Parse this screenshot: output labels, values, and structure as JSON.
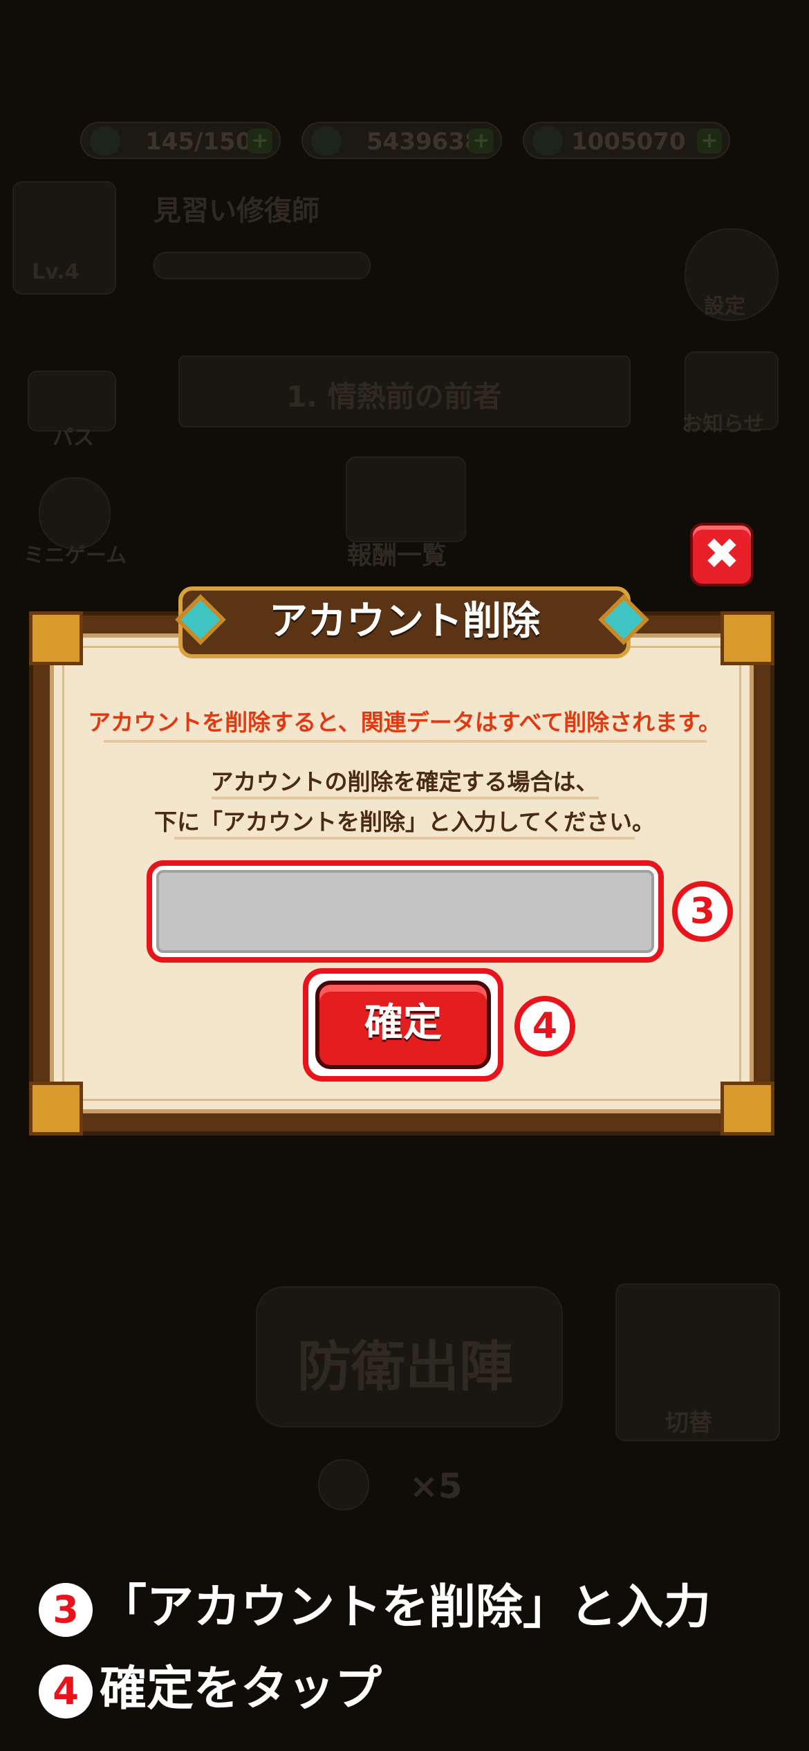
{
  "background": {
    "resources": [
      "145/150",
      "5439638",
      "1005070"
    ],
    "player_title": "見習い修復師",
    "player_level": "Lv.4",
    "settings_label": "設定",
    "news_label": "お知らせ",
    "pass_label": "パス",
    "minigame_label": "ミニゲーム",
    "stage_title": "1. 情熱前の前者",
    "rewards_label": "報酬一覧",
    "defense_button": "防衛出陣",
    "multiplier": "×5",
    "switch_label": "切替"
  },
  "dialog": {
    "title": "アカウント削除",
    "warning": "アカウントを削除すると、関連データはすべて削除されます。",
    "instruction_line1": "アカウントの削除を確定する場合は、",
    "instruction_line2": "下に「アカウントを削除」と入力してください。",
    "input_value": "",
    "input_placeholder": "",
    "confirm_label": "確定",
    "close_glyph": "✖"
  },
  "annotations": {
    "step3_badge": "3",
    "step4_badge": "4",
    "caption_step3_num": "3",
    "caption_step3_text": "「アカウントを削除」と入力",
    "caption_step4_num": "4",
    "caption_step4_text": "確定をタップ"
  },
  "colors": {
    "highlight": "#e8131b",
    "dialog_bg": "#f3e6cc",
    "frame": "#5a3412",
    "confirm": "#e41e1e"
  }
}
